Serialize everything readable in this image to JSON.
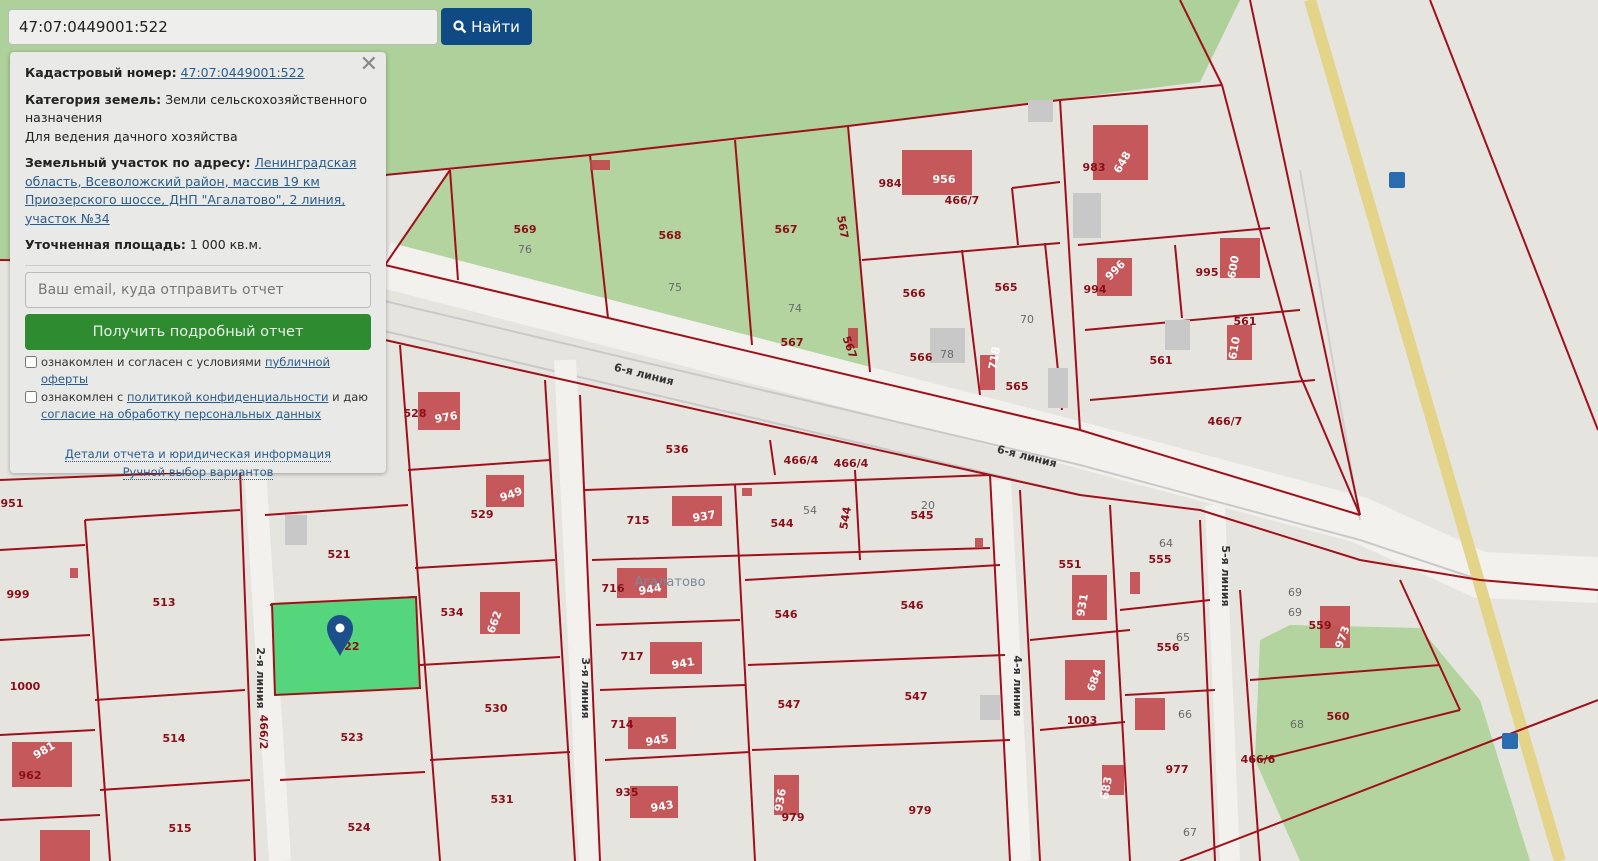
{
  "search": {
    "value": "47:07:0449001:522",
    "button_label": "Найти",
    "button_icon": "search-icon"
  },
  "panel": {
    "cadastral_label": "Кадастровый номер:",
    "cadastral_value": "47:07:0449001:522",
    "category_label": "Категория земель:",
    "category_value": "Земли сельскохозяйственного назначения",
    "usage": "Для ведения дачного хозяйства",
    "address_label": "Земельный участок по адресу:",
    "address_value": "Ленинградская область, Всеволожский район, массив 19 км Приозерского шоссе, ДНП \"Агалатово\", 2 линия, участок №34",
    "area_label": "Уточненная площадь:",
    "area_value": "1 000 кв.м.",
    "email_placeholder": "Ваш email, куда отправить отчет",
    "report_button": "Получить подробный отчет",
    "check1_text": "ознакомлен и согласен с условиями",
    "check1_link": "публичной оферты",
    "check2_text": "ознакомлен с",
    "check2_link": "политикой конфиденциальности",
    "check2_mid": "и даю",
    "check2_link2": "согласие на обработку персональных данных",
    "details_link": "Детали отчета и юридическая информация",
    "manual_link": "Ручной выбор вариантов"
  },
  "colors": {
    "accent": "#0f4a84",
    "report_button": "#2e8b2f",
    "parcel_line": "#a0101a",
    "selected_parcel": "#55d67c",
    "green_area": "#aed09a",
    "building": "#c0484c"
  },
  "map": {
    "labels": [
      "569",
      "76",
      "568",
      "75",
      "567",
      "567",
      "74",
      "567",
      "567",
      "984",
      "956",
      "466/7",
      "983",
      "648",
      "566",
      "565",
      "70",
      "566",
      "78",
      "718",
      "565",
      "994",
      "996",
      "995",
      "600",
      "561",
      "561",
      "610",
      "466/7",
      "536",
      "466/4",
      "466/4",
      "6-я линия",
      "6-я линия",
      "528",
      "976",
      "951",
      "529",
      "949",
      "715",
      "937",
      "544",
      "54",
      "544",
      "545",
      "20",
      "521",
      "999",
      "513",
      "534",
      "662",
      "716",
      "944",
      "Агалатово",
      "546",
      "546",
      "551",
      "555",
      "64",
      "5-я линия",
      "69",
      "69",
      "931",
      "556",
      "65",
      "559",
      "973",
      "522",
      "1000",
      "717",
      "941",
      "2-я линия",
      "466/2",
      "3-я линия",
      "4-я линия",
      "530",
      "547",
      "547",
      "684",
      "1003",
      "66",
      "68",
      "560",
      "514",
      "523",
      "714",
      "945",
      "981",
      "962",
      "466/6",
      "977",
      "683",
      "531",
      "935",
      "943",
      "936",
      "979",
      "979",
      "515",
      "524",
      "67"
    ]
  }
}
